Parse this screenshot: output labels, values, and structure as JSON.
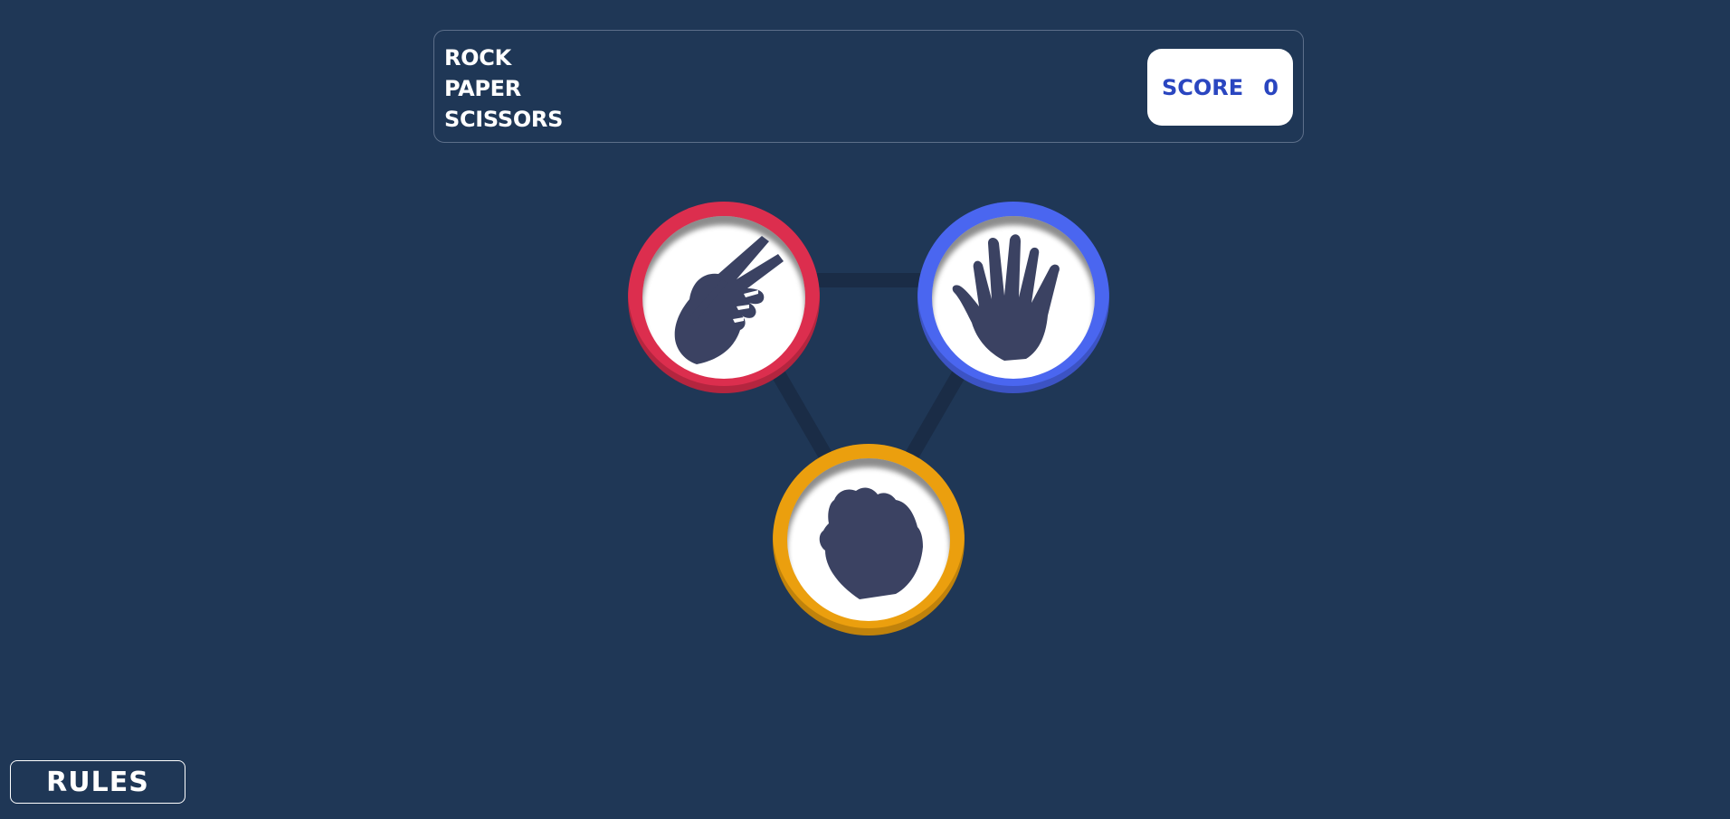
{
  "header": {
    "title_lines": [
      "ROCK",
      "PAPER",
      "SCISSORS"
    ],
    "score_label": "SCORE",
    "score_value": "0"
  },
  "choices": [
    {
      "name": "scissors",
      "icon": "scissors-hand-icon",
      "ring_color": "#dc2e4e"
    },
    {
      "name": "paper",
      "icon": "paper-hand-icon",
      "ring_color": "#4a66f0"
    },
    {
      "name": "rock",
      "icon": "rock-fist-icon",
      "ring_color": "#eb9f0e"
    }
  ],
  "rules_button": "RULES",
  "colors": {
    "background": "#1f3756",
    "score_text": "#2a46c0",
    "hand": "#3b4262",
    "connector": "#1a2c46"
  }
}
